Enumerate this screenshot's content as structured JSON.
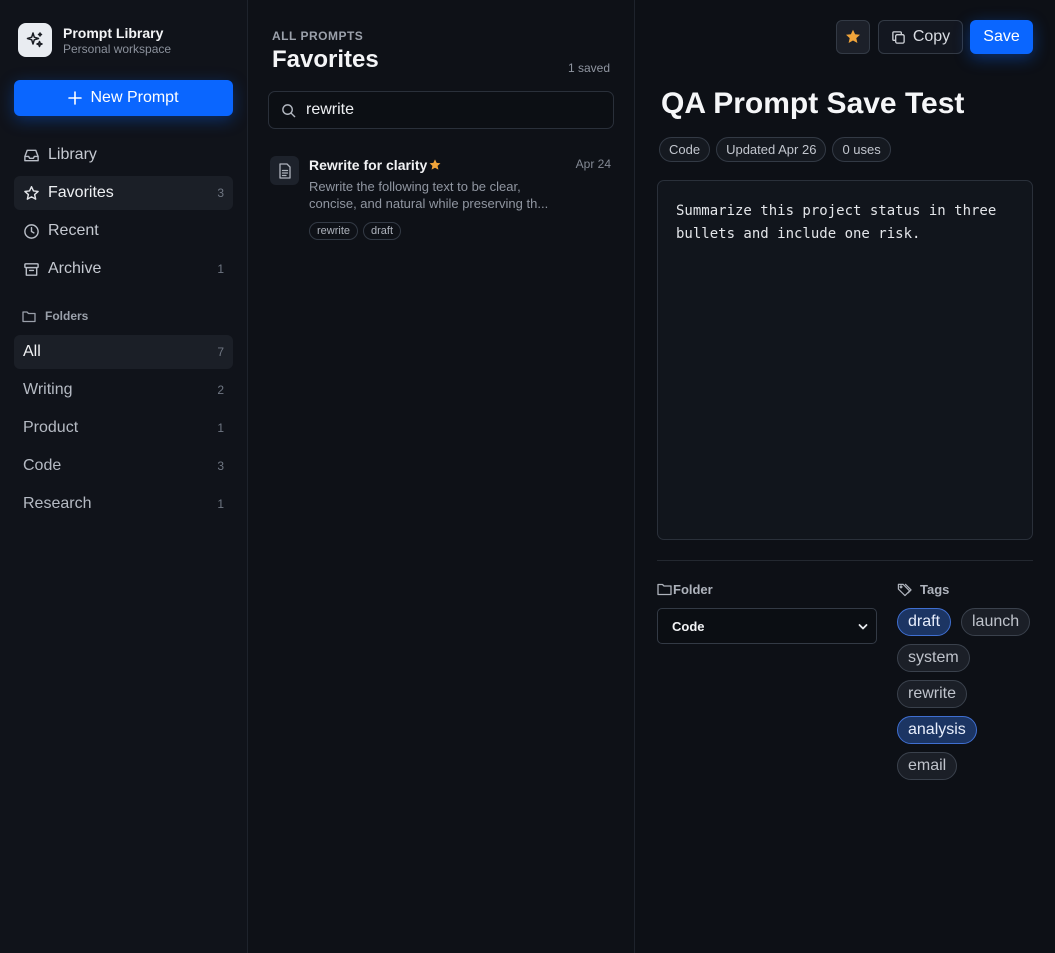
{
  "app": {
    "title": "Prompt Library",
    "workspace": "Personal workspace"
  },
  "sidebar": {
    "new_prompt": "New Prompt",
    "nav": [
      {
        "label": "Library",
        "icon": "inbox-icon",
        "count": ""
      },
      {
        "label": "Favorites",
        "icon": "star-outline-icon",
        "count": "3"
      },
      {
        "label": "Recent",
        "icon": "clock-icon",
        "count": ""
      },
      {
        "label": "Archive",
        "icon": "archive-icon",
        "count": "1"
      }
    ],
    "folders_heading": "Folders",
    "folders": [
      {
        "label": "All",
        "count": "7"
      },
      {
        "label": "Writing",
        "count": "2"
      },
      {
        "label": "Product",
        "count": "1"
      },
      {
        "label": "Code",
        "count": "3"
      },
      {
        "label": "Research",
        "count": "1"
      }
    ]
  },
  "list": {
    "eyebrow": "ALL PROMPTS",
    "title": "Favorites",
    "saved_count": "1 saved",
    "search_value": "rewrite",
    "items": [
      {
        "title": "Rewrite for clarity",
        "date": "Apr 24",
        "description": "Rewrite the following text to be clear, concise, and natural while preserving th...",
        "tags": [
          "rewrite",
          "draft"
        ]
      }
    ]
  },
  "editor": {
    "copy_label": "Copy",
    "save_label": "Save",
    "title": "QA Prompt Save Test",
    "meta": [
      "Code",
      "Updated Apr 26",
      "0 uses"
    ],
    "body": "Summarize this project status in three bullets and include one risk.",
    "folder_label": "Folder",
    "folder_value": "Code",
    "tags_label": "Tags",
    "tags": [
      {
        "label": "draft",
        "selected": true
      },
      {
        "label": "launch",
        "selected": false
      },
      {
        "label": "system",
        "selected": false
      },
      {
        "label": "rewrite",
        "selected": false
      },
      {
        "label": "analysis",
        "selected": true
      },
      {
        "label": "email",
        "selected": false
      }
    ]
  },
  "colors": {
    "accent": "#0a66ff",
    "star": "#f0a43a",
    "background": "#0d1016"
  }
}
